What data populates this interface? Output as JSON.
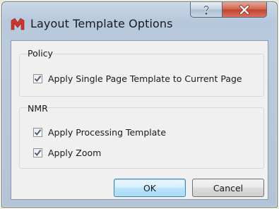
{
  "window": {
    "title": "Layout Template Options",
    "help_glyph": "?",
    "close_glyph": "✕"
  },
  "colors": {
    "app_icon_red": "#d0342c",
    "close_button_red": "#c2412a",
    "check_mark": "#4a5f7a"
  },
  "groups": [
    {
      "label": "Policy",
      "options": [
        {
          "label": "Apply Single Page Template to Current Page",
          "checked": true
        }
      ]
    },
    {
      "label": "NMR",
      "options": [
        {
          "label": "Apply Processing Template",
          "checked": true
        },
        {
          "label": "Apply Zoom",
          "checked": true
        }
      ]
    }
  ],
  "buttons": {
    "ok": "OK",
    "cancel": "Cancel"
  }
}
